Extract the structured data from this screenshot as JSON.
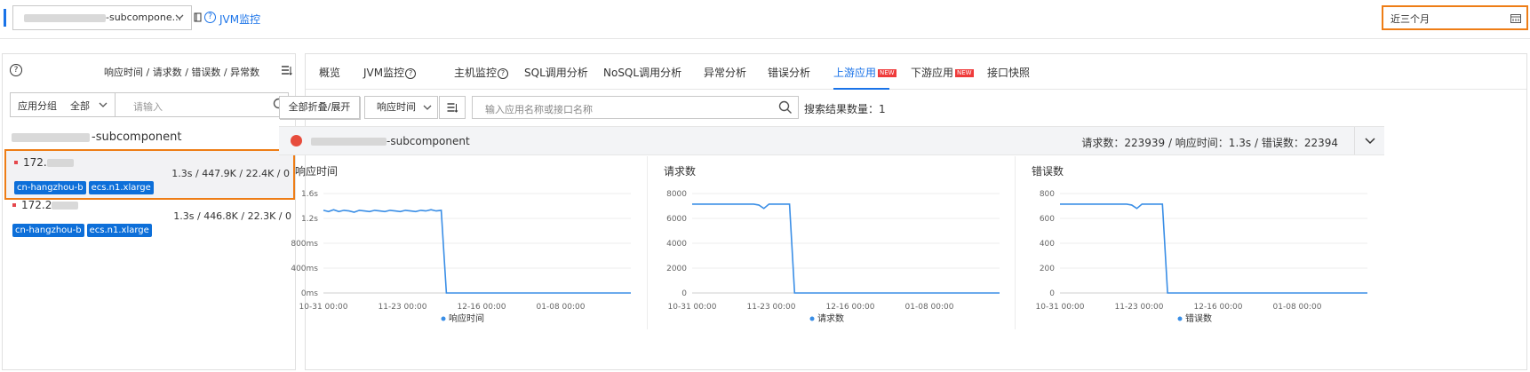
{
  "topbar": {
    "app_selector_suffix": "-subcompone...",
    "jvm_link": "JVM监控",
    "date_range": "近三个月"
  },
  "left": {
    "metrics_header": "响应时间 / 请求数 / 错误数 / 异常数",
    "filter": {
      "group_label": "应用分组",
      "group_value": "全部",
      "search_placeholder": "请输入"
    },
    "app_suffix": "-subcomponent",
    "hosts": [
      {
        "ip_prefix": "172.",
        "stats": "1.3s / 447.9K / 22.4K / 0",
        "tags": [
          "cn-hangzhou-b",
          "ecs.n1.xlarge"
        ],
        "selected": true
      },
      {
        "ip_prefix": "172.2",
        "stats": "1.3s / 446.8K / 22.3K / 0",
        "tags": [
          "cn-hangzhou-b",
          "ecs.n1.xlarge"
        ],
        "selected": false
      }
    ]
  },
  "tabs": [
    {
      "label": "概览"
    },
    {
      "label": "JVM监控",
      "help": true
    },
    {
      "label": "主机监控",
      "help": true
    },
    {
      "label": "SQL调用分析"
    },
    {
      "label": "NoSQL调用分析"
    },
    {
      "label": "异常分析"
    },
    {
      "label": "错误分析"
    },
    {
      "label": "上游应用",
      "badge": "NEW",
      "active": true
    },
    {
      "label": "下游应用",
      "badge": "NEW"
    },
    {
      "label": "接口快照"
    }
  ],
  "toolbar": {
    "collapse_label": "全部折叠/展开",
    "sort_value": "响应时间",
    "search_placeholder": "输入应用名称或接口名称",
    "result_count_label": "搜索结果数量：",
    "result_count": "1"
  },
  "service": {
    "name_suffix": "-subcomponent",
    "summary": "请求数：223939 / 响应时间：1.3s / 错误数：22394",
    "status_color": "#e74c3c"
  },
  "colors": {
    "accent": "#1a73e8",
    "highlight": "#ee7d16",
    "tag": "#0d6fd9",
    "series": "#3a8ee6"
  },
  "chart_data": [
    {
      "type": "line",
      "title": "响应时间",
      "x_ticks": [
        "10-31 00:00",
        "11-23 00:00",
        "12-16 00:00",
        "01-08 00:00"
      ],
      "y_ticks": [
        "0ms",
        "400ms",
        "800ms",
        "1.2s",
        "1.6s"
      ],
      "ylim": [
        0,
        1.6
      ],
      "series": [
        {
          "name": "响应时间",
          "points": [
            [
              0,
              1.33
            ],
            [
              1,
              1.31
            ],
            [
              2,
              1.34
            ],
            [
              3,
              1.31
            ],
            [
              4,
              1.33
            ],
            [
              5,
              1.32
            ],
            [
              6,
              1.3
            ],
            [
              7,
              1.33
            ],
            [
              8,
              1.32
            ],
            [
              9,
              1.31
            ],
            [
              10,
              1.33
            ],
            [
              11,
              1.32
            ],
            [
              12,
              1.31
            ],
            [
              13,
              1.33
            ],
            [
              14,
              1.32
            ],
            [
              15,
              1.31
            ],
            [
              16,
              1.33
            ],
            [
              17,
              1.32
            ],
            [
              18,
              1.31
            ],
            [
              19,
              1.33
            ],
            [
              20,
              1.32
            ],
            [
              21,
              1.34
            ],
            [
              22,
              1.32
            ],
            [
              23,
              1.33
            ],
            [
              24,
              0
            ],
            [
              60,
              0
            ]
          ]
        }
      ]
    },
    {
      "type": "line",
      "title": "请求数",
      "x_ticks": [
        "10-31 00:00",
        "11-23 00:00",
        "12-16 00:00",
        "01-08 00:00"
      ],
      "y_ticks": [
        "0",
        "2000",
        "4000",
        "6000",
        "8000"
      ],
      "ylim": [
        0,
        8000
      ],
      "series": [
        {
          "name": "请求数",
          "points": [
            [
              0,
              7150
            ],
            [
              12,
              7150
            ],
            [
              13,
              7080
            ],
            [
              14,
              6800
            ],
            [
              15,
              7150
            ],
            [
              19,
              7150
            ],
            [
              20,
              0
            ],
            [
              60,
              0
            ]
          ]
        }
      ]
    },
    {
      "type": "line",
      "title": "错误数",
      "x_ticks": [
        "10-31 00:00",
        "11-23 00:00",
        "12-16 00:00",
        "01-08 00:00"
      ],
      "y_ticks": [
        "0",
        "200",
        "400",
        "600",
        "800"
      ],
      "ylim": [
        0,
        800
      ],
      "series": [
        {
          "name": "错误数",
          "points": [
            [
              0,
              715
            ],
            [
              13,
              715
            ],
            [
              14,
              708
            ],
            [
              15,
              680
            ],
            [
              16,
              715
            ],
            [
              20,
              715
            ],
            [
              21,
              0
            ],
            [
              60,
              0
            ]
          ]
        }
      ]
    }
  ]
}
